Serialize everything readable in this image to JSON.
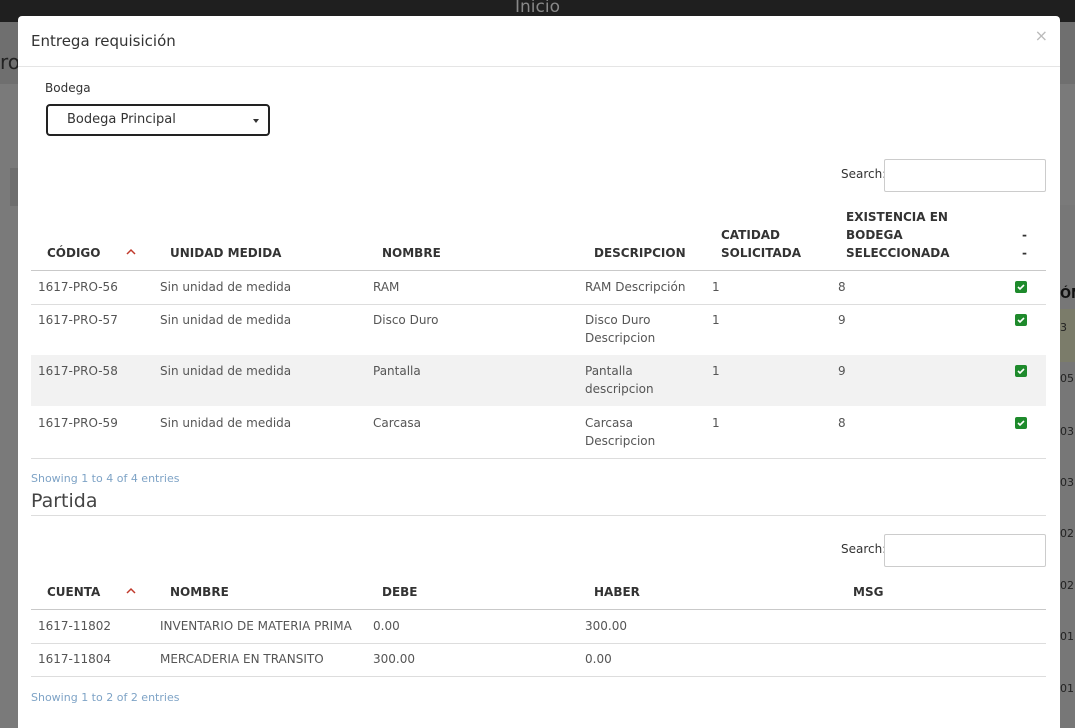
{
  "background": {
    "topbar_title": "Inicio",
    "left_text": "ro",
    "right_header": "ÓN",
    "right_cells": [
      "3",
      "05",
      "03",
      "03",
      "02",
      "02",
      "01",
      "01"
    ]
  },
  "modal": {
    "title": "Entrega requisición",
    "close": "×"
  },
  "bodega": {
    "label": "Bodega",
    "selected": "Bodega Principal"
  },
  "table1": {
    "search_label": "Search:",
    "search_value": "",
    "headers": {
      "codigo": "CÓDIGO",
      "unidad": "UNIDAD MEDIDA",
      "nombre": "NOMBRE",
      "descripcion": "DESCRIPCION",
      "cantidad_1": "CATIDAD",
      "cantidad_2": "SOLICITADA",
      "existencia_1": "EXISTENCIA EN",
      "existencia_2": "BODEGA",
      "existencia_3": "SELECCIONADA",
      "dash_1": "-",
      "dash_2": "-"
    },
    "rows": [
      {
        "codigo": "1617-PRO-56",
        "unidad": "Sin unidad de medida",
        "nombre": "RAM",
        "desc_1": "RAM Descripción",
        "desc_2": "",
        "cantidad": "1",
        "existencia": "8"
      },
      {
        "codigo": "1617-PRO-57",
        "unidad": "Sin unidad de medida",
        "nombre": "Disco Duro",
        "desc_1": "Disco Duro",
        "desc_2": "Descripcion",
        "cantidad": "1",
        "existencia": "9"
      },
      {
        "codigo": "1617-PRO-58",
        "unidad": "Sin unidad de medida",
        "nombre": "Pantalla",
        "desc_1": "Pantalla",
        "desc_2": "descripcion",
        "cantidad": "1",
        "existencia": "9"
      },
      {
        "codigo": "1617-PRO-59",
        "unidad": "Sin unidad de medida",
        "nombre": "Carcasa",
        "desc_1": "Carcasa",
        "desc_2": "Descripcion",
        "cantidad": "1",
        "existencia": "8"
      }
    ],
    "info": "Showing 1 to 4 of 4 entries"
  },
  "partida": {
    "title": "Partida",
    "search_label": "Search:",
    "search_value": "",
    "headers": {
      "cuenta": "CUENTA",
      "nombre": "NOMBRE",
      "debe": "DEBE",
      "haber": "HABER",
      "msg": "MSG"
    },
    "rows": [
      {
        "cuenta": "1617-11802",
        "nombre": "INVENTARIO DE MATERIA PRIMA",
        "debe": "0.00",
        "haber": "300.00",
        "msg": ""
      },
      {
        "cuenta": "1617-11804",
        "nombre": "MERCADERIA EN TRANSITO",
        "debe": "300.00",
        "haber": "0.00",
        "msg": ""
      }
    ],
    "info": "Showing 1 to 2 of 2 entries"
  },
  "colors": {
    "checkbox": "#1e8a2c",
    "sort_arrow": "#c0392b",
    "info_text": "#7ea3c6"
  },
  "icons": {
    "sort": "chevron-up-icon",
    "check": "check-icon",
    "caret": "caret-down-icon",
    "close": "close-icon"
  }
}
